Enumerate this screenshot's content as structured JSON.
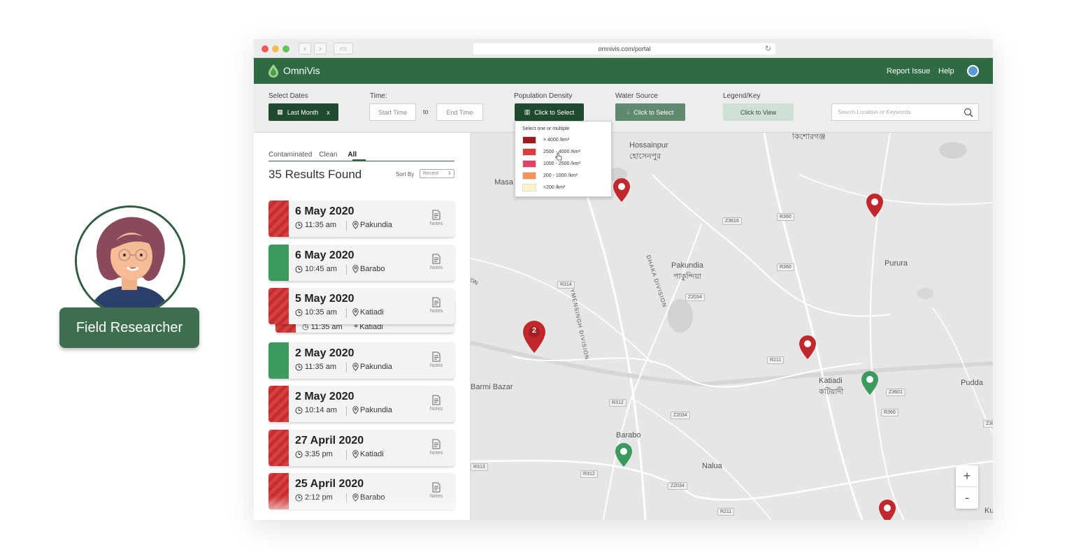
{
  "persona": {
    "label": "Field Researcher"
  },
  "browser": {
    "url": "omnivis.com/portal"
  },
  "app": {
    "name": "OmniVis",
    "links": {
      "report": "Report Issue",
      "help": "Help"
    },
    "brand_color": "#2e6a42"
  },
  "filters": {
    "dates_label": "Select Dates",
    "dates_value": "Last Month",
    "dates_clear": "x",
    "time_label": "Time:",
    "start_placeholder": "Start Time",
    "to": "to",
    "end_placeholder": "End Time",
    "density_label": "Population Density",
    "density_btn": "Click to Select",
    "water_label": "Water Source",
    "water_btn": "Click to Select",
    "legend_label": "Legend/Key",
    "legend_btn": "Click to View",
    "search_placeholder": "Search Location or Keywords"
  },
  "density_dropdown": {
    "header": "Select one or multiple",
    "options": [
      {
        "label": "> 4000 /km²",
        "color": "#9b1c1c"
      },
      {
        "label": "2500 - 4000 /km²",
        "color": "#d6403a"
      },
      {
        "label": "1000 - 2500 /km²",
        "color": "#e4416a"
      },
      {
        "label": "200 - 1000 /km²",
        "color": "#f0945a"
      },
      {
        "label": "<200 /km²",
        "color": "#fdf3c4"
      }
    ]
  },
  "panel": {
    "tabs": [
      "Contaminated",
      "Clean",
      "All"
    ],
    "active_tab": "All",
    "results": "35 Results Found",
    "sort_label": "Sort By",
    "sort_value": "Recent"
  },
  "records": [
    {
      "date": "6 May 2020",
      "time": "11:35 am",
      "location": "Pakundia",
      "status": "contaminated",
      "notes": "Notes"
    },
    {
      "date": "6 May 2020",
      "time": "10:45 am",
      "location": "Barabo",
      "status": "clean",
      "notes": "Notes"
    },
    {
      "date": "5 May 2020",
      "time": "10:35 am",
      "location": "Katiadi",
      "status": "contaminated",
      "notes": "Notes"
    },
    {
      "date": "2 May 2020",
      "time": "11:35 am",
      "location": "Pakundia",
      "status": "clean",
      "notes": "Notes"
    },
    {
      "date": "2 May 2020",
      "time": "10:14 am",
      "location": "Pakundia",
      "status": "contaminated",
      "notes": "Notes"
    },
    {
      "date": "27 April 2020",
      "time": "3:35 pm",
      "location": "Katiadi",
      "status": "contaminated",
      "notes": "Notes"
    },
    {
      "date": "25 April 2020",
      "time": "2:12 pm",
      "location": "Barabo",
      "status": "contaminated",
      "notes": "Notes"
    }
  ],
  "stacked_peek": {
    "time": "11:35 am",
    "location": "Katiadi"
  },
  "map": {
    "places": [
      "Hossainpur",
      "হোসেনপুর",
      "কিশোরগঞ্জ",
      "Masa",
      "Pakundia",
      "পাকুন্দিয়া",
      "Purura",
      "Katiadi",
      "কটিয়াদী",
      "Pudda",
      "Barmi Bazar",
      "Barabo",
      "Nalua",
      "Ku",
      "MYMENSINGH DIVISION",
      "DHAKA DIVISION",
      "ION"
    ],
    "roads": [
      "Z3616",
      "R360",
      "R360",
      "R314",
      "Z2034",
      "R211",
      "Z3601",
      "R360",
      "Z36",
      "R312",
      "Z2034",
      "R313",
      "R312",
      "Z2034",
      "R211"
    ],
    "cluster_count": "2",
    "zoom_in": "+",
    "zoom_out": "-",
    "pin_colors": {
      "contaminated": "#c0282d",
      "clean": "#3d9a5e"
    }
  }
}
